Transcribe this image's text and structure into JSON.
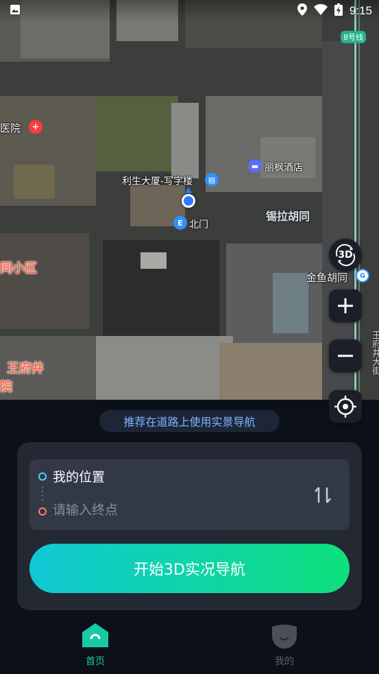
{
  "status_bar": {
    "time": "9:15",
    "icons": [
      "image-icon",
      "location-icon",
      "wifi-icon",
      "battery-charging-icon"
    ]
  },
  "map": {
    "metro_line_badge": "8号线",
    "labels": {
      "hospital": "医院",
      "building": "利生大厦-写字楼",
      "hotel": "丽枫酒店",
      "north_gate": "北门",
      "hutong1": "锡拉胡同",
      "community": "同小区",
      "hutong2": "金鱼胡同",
      "wangfujing": "王府井",
      "hospital2": "院",
      "street_vertical": "王府井大街"
    },
    "controls": {
      "mode_3d": "3D",
      "zoom_in": "+",
      "zoom_out": "−"
    }
  },
  "panel": {
    "tip": "推荐在道路上使用实景导航",
    "start_label": "我的位置",
    "end_placeholder": "请输入终点",
    "start_button": "开始3D实况导航"
  },
  "tabs": [
    {
      "label": "首页",
      "active": true,
      "color": "#18c9a6"
    },
    {
      "label": "我的",
      "active": false,
      "color": "#5a5f69"
    }
  ],
  "colors": {
    "accent_start": "#11c8d6",
    "accent_end": "#0ee07b",
    "tip_text": "#7fb4ff",
    "background": "#0c1019"
  }
}
